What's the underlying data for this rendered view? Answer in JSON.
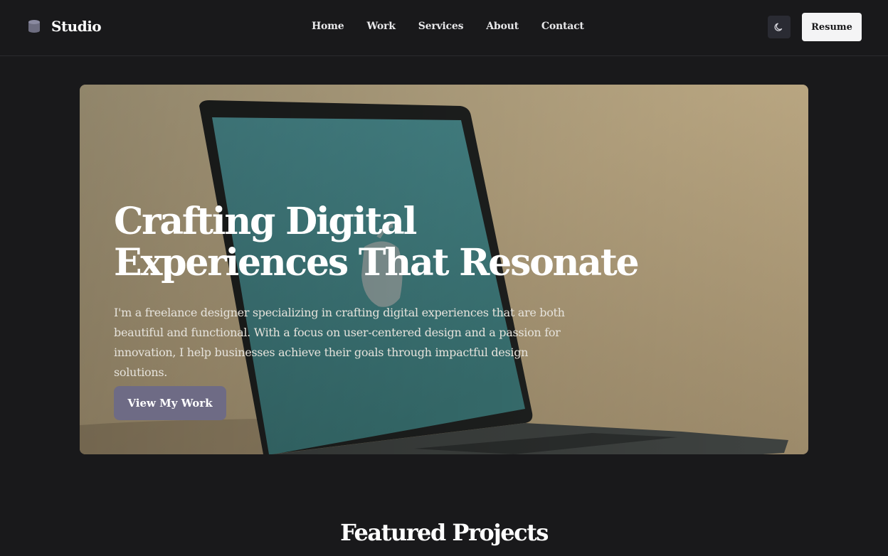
{
  "brand": {
    "name": "Studio",
    "icon": "database-icon"
  },
  "nav": {
    "links": [
      "Home",
      "Work",
      "Services",
      "About",
      "Contact"
    ],
    "theme_toggle_icon": "moon-icon",
    "resume_label": "Resume"
  },
  "hero": {
    "title": "Crafting Digital Experiences That Resonate",
    "subtitle": "I'm a freelance designer specializing in crafting digital experiences that are both beautiful and functional. With a focus on user-centered design and a passion for innovation, I help businesses achieve their goals through impactful design solutions.",
    "cta_label": "View My Work",
    "background": "laptop-photo"
  },
  "featured": {
    "title": "Featured Projects"
  },
  "colors": {
    "page_bg": "#19191b",
    "cta_bg": "#6e6b85",
    "resume_bg": "#f4f4f5",
    "toggle_bg": "#2a2b33"
  }
}
